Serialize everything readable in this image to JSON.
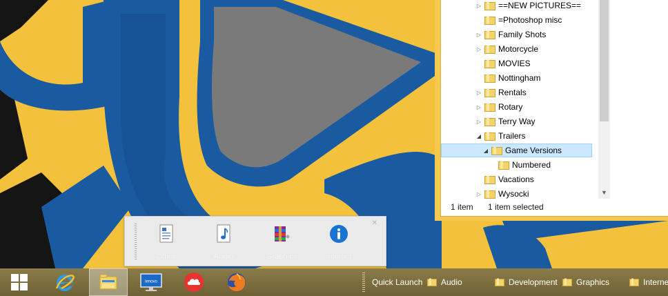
{
  "explorer": {
    "tree": [
      {
        "label": "==NEW PICTURES==",
        "expander": "collapsed",
        "indent": 0
      },
      {
        "label": "=Photoshop misc",
        "expander": "none",
        "indent": 0
      },
      {
        "label": "Family Shots",
        "expander": "collapsed",
        "indent": 0
      },
      {
        "label": "Motorcycle",
        "expander": "collapsed",
        "indent": 0
      },
      {
        "label": "MOVIES",
        "expander": "none",
        "indent": 0
      },
      {
        "label": "Nottingham",
        "expander": "none",
        "indent": 0
      },
      {
        "label": "Rentals",
        "expander": "collapsed",
        "indent": 0
      },
      {
        "label": "Rotary",
        "expander": "collapsed",
        "indent": 0
      },
      {
        "label": "Terry Way",
        "expander": "collapsed",
        "indent": 0
      },
      {
        "label": "Trailers",
        "expander": "expanded",
        "indent": 0
      },
      {
        "label": "Game Versions",
        "expander": "expanded",
        "indent": 1,
        "selected": true
      },
      {
        "label": "Numbered",
        "expander": "none",
        "indent": 2
      },
      {
        "label": "Vacations",
        "expander": "none",
        "indent": 0
      },
      {
        "label": "Wysocki",
        "expander": "collapsed",
        "indent": 0
      }
    ],
    "status": {
      "item_count": "1 item",
      "selection": "1 item selected"
    }
  },
  "toolbar_popup": {
    "items": [
      {
        "label": "Office",
        "icon": "document-icon"
      },
      {
        "label": "Audio",
        "icon": "music-note-icon"
      },
      {
        "label": "Graphics",
        "icon": "winrar-icon"
      },
      {
        "label": "Internet",
        "icon": "info-icon"
      }
    ],
    "close_glyph": "✕"
  },
  "taskbar": {
    "pinned": [
      {
        "name": "start-button",
        "icon": "windows-logo-icon"
      },
      {
        "name": "internet-explorer-button",
        "icon": "internet-explorer-icon"
      },
      {
        "name": "file-explorer-button",
        "icon": "file-explorer-icon",
        "active": true
      },
      {
        "name": "lenovo-button",
        "icon": "lenovo-monitor-icon"
      },
      {
        "name": "cloud-button",
        "icon": "cloud-icon"
      },
      {
        "name": "firefox-button",
        "icon": "firefox-icon"
      }
    ],
    "quick_launch_label": "Quick Launch",
    "toolbars": [
      {
        "label": "Audio"
      },
      {
        "label": "Development"
      },
      {
        "label": "Graphics"
      },
      {
        "label": "Interne"
      }
    ]
  },
  "colors": {
    "accent_yellow": "#f6c94e",
    "selection_bg": "#cce8ff",
    "taskbar": "#7a6c3d",
    "wallpaper_blue": "#1a5aa0",
    "wallpaper_yellow": "#f3c13c"
  }
}
